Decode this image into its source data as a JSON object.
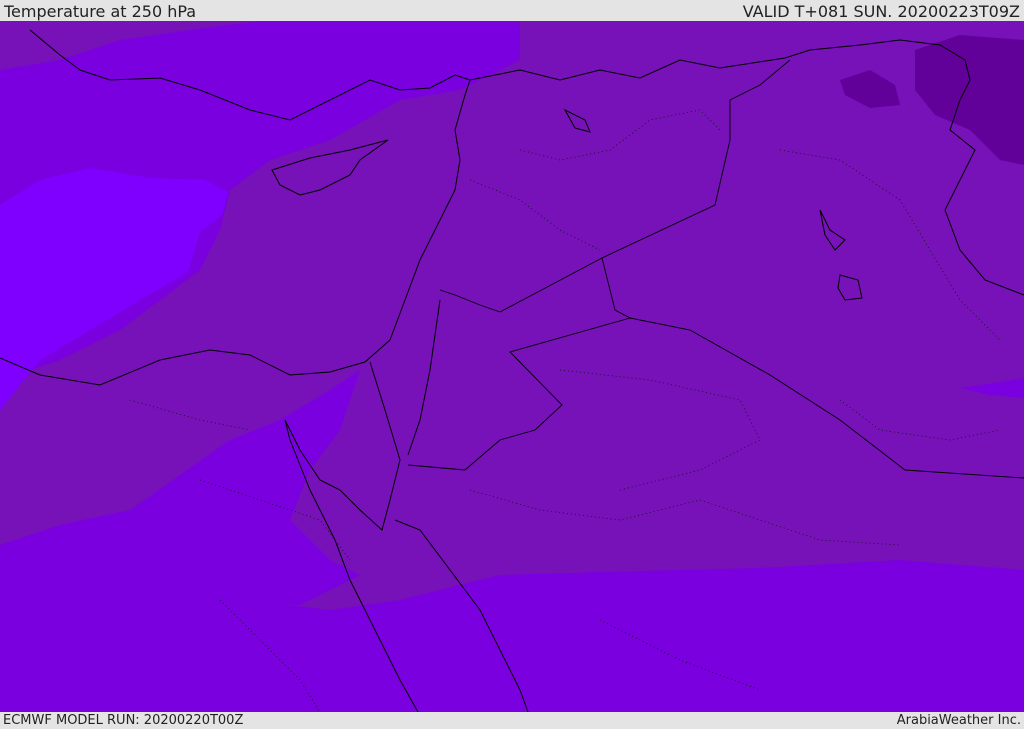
{
  "header": {
    "title": "Temperature at 250 hPa",
    "valid": "VALID T+081 SUN. 20200223T09Z"
  },
  "footer": {
    "model_run": "ECMWF MODEL RUN: 20200220T00Z",
    "credit": "ArabiaWeather Inc."
  },
  "map": {
    "variable": "Temperature",
    "level": "250 hPa",
    "colors": {
      "warm_band": "#7a00e0",
      "mid_band": "#7711b8",
      "cold_band": "#8000ff",
      "coldest_band": "#62009a",
      "coastline": "#000000"
    }
  }
}
